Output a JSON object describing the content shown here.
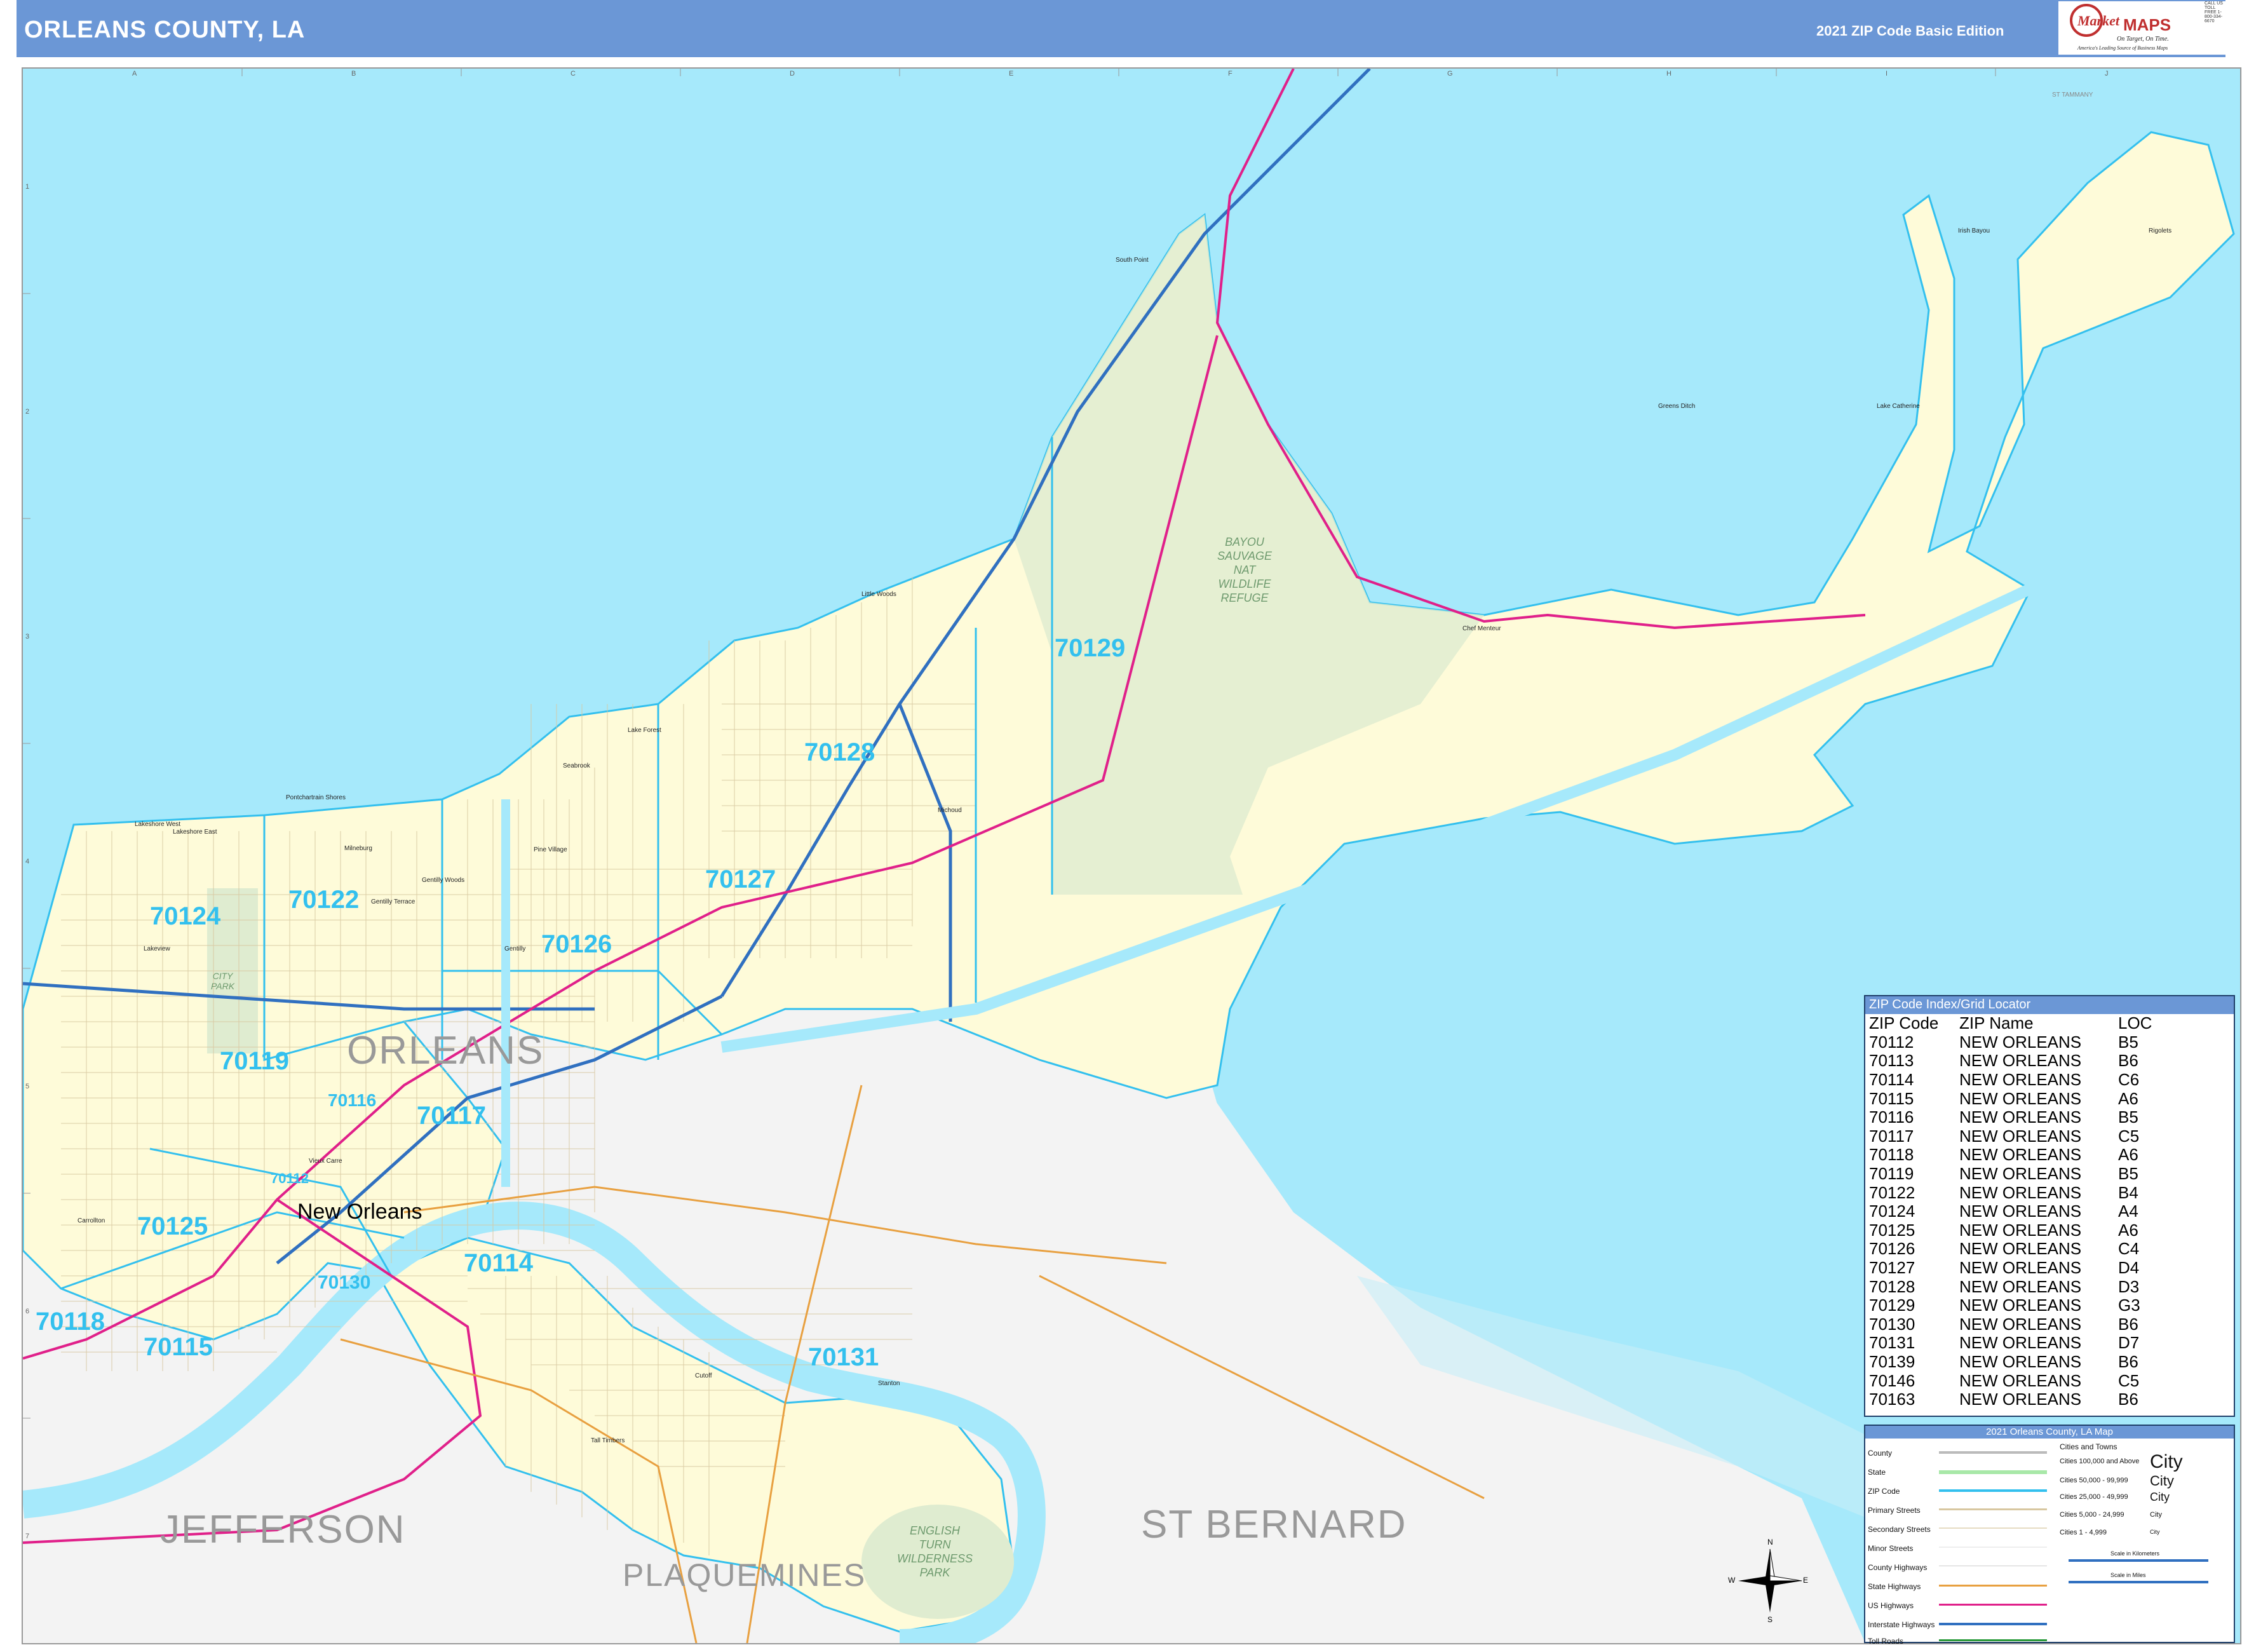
{
  "title": "ORLEANS COUNTY, LA",
  "edition": "2021 ZIP Code Basic Edition",
  "logo": {
    "brand_top": "Market",
    "brand_bottom": "MAPS",
    "tagline": "On Target, On Time.",
    "sub_tagline": "America's Leading Source of Business Maps",
    "contact": "CALL US TOLL FREE 1-800-334-6670"
  },
  "colors": {
    "water": "#a6e9fb",
    "land_county": "#fefbd9",
    "land_outside": "#f3f3f3",
    "zip_label": "#33c0ee",
    "header": "#6b97d6",
    "us_highway": "#e0208a",
    "interstate": "#3070c0",
    "state_highway": "#e8a040",
    "wildlife_area": "#dfecd0"
  },
  "grid": {
    "columns": [
      "A",
      "B",
      "C",
      "D",
      "E",
      "F",
      "G",
      "H",
      "I",
      "J"
    ],
    "rows": [
      "1",
      "2",
      "3",
      "4",
      "5",
      "6",
      "7"
    ]
  },
  "zip_labels": [
    "70129",
    "70128",
    "70127",
    "70126",
    "70124",
    "70122",
    "70119",
    "70116",
    "70117",
    "70125",
    "70112",
    "70130",
    "70114",
    "70118",
    "70115",
    "70131"
  ],
  "county_labels": [
    "ORLEANS",
    "JEFFERSON",
    "ST BERNARD",
    "PLAQUEMINES"
  ],
  "city_label": "New Orleans",
  "place_labels": [
    "South Point",
    "Little Woods",
    "Lake Forest",
    "Seabrook",
    "Pontchartrain Shores",
    "Lakeshore West",
    "Lakeshore East",
    "Milneburg",
    "Gentilly Woods",
    "Gentilly Terrace",
    "Gentilly",
    "Pine Village",
    "Michoud",
    "Lakeview",
    "Carrollton",
    "Vieux Carre",
    "Cutoff",
    "Stanton",
    "Tall Timbers",
    "Chef Menteur",
    "Lake Catherine",
    "Irish Bayou",
    "Rigolets",
    "Greens Ditch",
    "ST TAMMANY"
  ],
  "parks": [
    {
      "name": "BAYOU SAUVAGE NATIONAL WILDLIFE REFUGE",
      "lines": [
        "BAYOU",
        "SAUVAGE",
        "NAT",
        "WILDLIFE",
        "REFUGE"
      ]
    },
    {
      "name": "CITY PARK",
      "lines": [
        "CITY",
        "PARK"
      ]
    },
    {
      "name": "ENGLISH TURN WILDERNESS PARK",
      "lines": [
        "ENGLISH",
        "TURN",
        "WILDERNESS",
        "PARK"
      ]
    }
  ],
  "zip_index": {
    "title": "ZIP Code Index/Grid Locator",
    "headers": [
      "ZIP Code",
      "ZIP Name",
      "LOC"
    ],
    "rows": [
      [
        "70112",
        "NEW ORLEANS",
        "B5"
      ],
      [
        "70113",
        "NEW ORLEANS",
        "B6"
      ],
      [
        "70114",
        "NEW ORLEANS",
        "C6"
      ],
      [
        "70115",
        "NEW ORLEANS",
        "A6"
      ],
      [
        "70116",
        "NEW ORLEANS",
        "B5"
      ],
      [
        "70117",
        "NEW ORLEANS",
        "C5"
      ],
      [
        "70118",
        "NEW ORLEANS",
        "A6"
      ],
      [
        "70119",
        "NEW ORLEANS",
        "B5"
      ],
      [
        "70122",
        "NEW ORLEANS",
        "B4"
      ],
      [
        "70124",
        "NEW ORLEANS",
        "A4"
      ],
      [
        "70125",
        "NEW ORLEANS",
        "A6"
      ],
      [
        "70126",
        "NEW ORLEANS",
        "C4"
      ],
      [
        "70127",
        "NEW ORLEANS",
        "D4"
      ],
      [
        "70128",
        "NEW ORLEANS",
        "D3"
      ],
      [
        "70129",
        "NEW ORLEANS",
        "G3"
      ],
      [
        "70130",
        "NEW ORLEANS",
        "B6"
      ],
      [
        "70131",
        "NEW ORLEANS",
        "D7"
      ],
      [
        "70139",
        "NEW ORLEANS",
        "B6"
      ],
      [
        "70146",
        "NEW ORLEANS",
        "C5"
      ],
      [
        "70163",
        "NEW ORLEANS",
        "B6"
      ]
    ]
  },
  "legend": {
    "title": "2021 Orleans County, LA Map",
    "items": [
      "County",
      "State",
      "ZIP Code",
      "Primary Streets",
      "Secondary Streets",
      "Minor Streets",
      "County Highways",
      "State Highways",
      "US Highways",
      "Interstate Highways",
      "Toll Roads"
    ],
    "cities_title": "Cities and Towns",
    "city_classes": [
      {
        "range": "Cities 100,000 and Above",
        "sample": "City"
      },
      {
        "range": "Cities 50,000 - 99,999",
        "sample": "City"
      },
      {
        "range": "Cities 25,000 - 49,999",
        "sample": "City"
      },
      {
        "range": "Cities 5,000 - 24,999",
        "sample": "City"
      },
      {
        "range": "Cities 1 - 4,999",
        "sample": "City"
      }
    ],
    "scale_km": "Scale in Kilometers",
    "scale_mi": "Scale in Miles"
  },
  "compass": {
    "n": "N",
    "s": "S",
    "e": "E",
    "w": "W"
  }
}
